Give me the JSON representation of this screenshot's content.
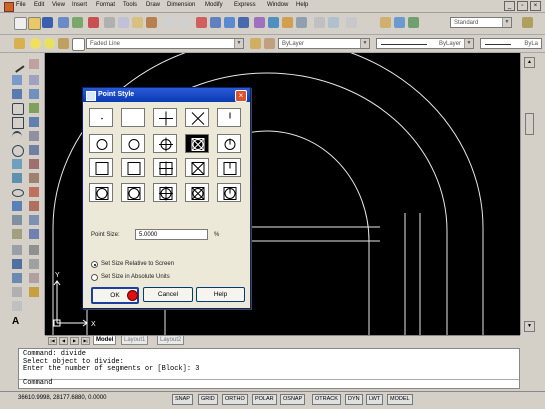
{
  "menu": [
    "File",
    "Edit",
    "View",
    "Insert",
    "Format",
    "Tools",
    "Draw",
    "Dimension",
    "Modify",
    "Express",
    "Window",
    "Help"
  ],
  "toolbar": {
    "style_combo": "Standard",
    "layer_combo": "Faded Line",
    "color_combo": "ByLayer",
    "linetype_combo": "ByLayer",
    "lineweight_combo": "ByLa"
  },
  "dialog": {
    "title": "Point Style",
    "point_size_label": "Point Size:",
    "point_size_value": "5.0000",
    "percent": "%",
    "relative_label": "Set Size Relative to Screen",
    "absolute_label": "Set Size in Absolute Units",
    "ok": "OK",
    "cancel": "Cancel",
    "help": "Help",
    "selected_style": "box-x"
  },
  "tabs": {
    "model": "Model",
    "layout1": "Layout1",
    "layout2": "Layout2"
  },
  "command": {
    "lines": [
      "Command: divide",
      "Select object to divide:",
      "Enter the number of segments or [Block]: 3"
    ],
    "prompt": "Command"
  },
  "status": {
    "coords": "36610.9998, 28177.6880, 0.0000",
    "toggles": [
      "SNAP",
      "GRID",
      "ORTHO",
      "POLAR",
      "OSNAP",
      "OTRACK",
      "DYN",
      "LWT",
      "MODEL"
    ]
  },
  "colors": {
    "title_bar": "#0a3ab0",
    "drawing_bg": "#000000",
    "ok_cursor": "#e01010"
  }
}
